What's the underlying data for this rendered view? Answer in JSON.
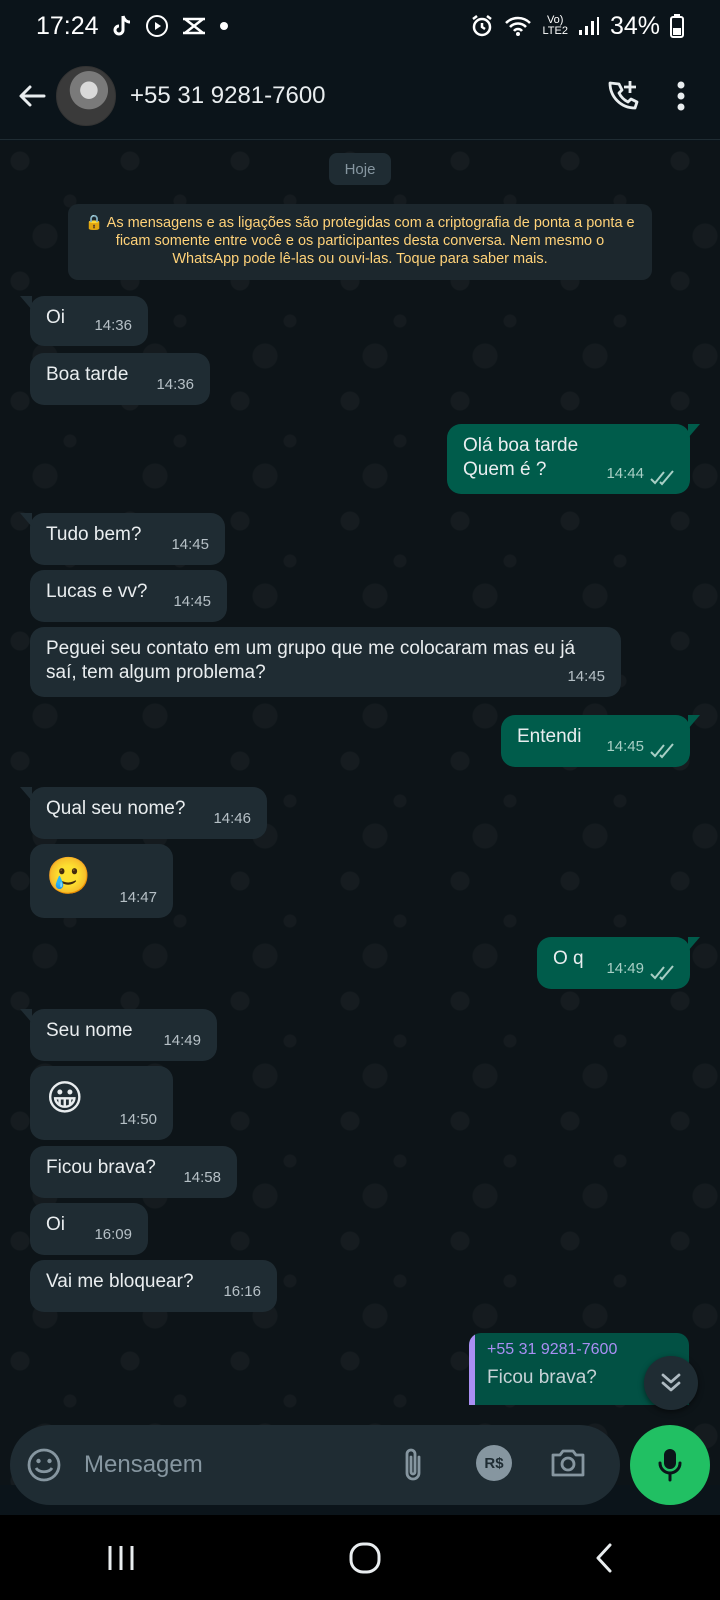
{
  "status_bar": {
    "time": "17:24",
    "battery": "34%",
    "network": "LTE2",
    "volte": "Vo)"
  },
  "header": {
    "contact_name": "+55 31 9281-7600"
  },
  "chat": {
    "date_chip": "Hoje",
    "encryption_notice": "🔒 As mensagens e as ligações são protegidas com a criptografia de ponta a ponta e ficam somente entre você e os participantes desta conversa. Nem mesmo o WhatsApp pode lê-las ou ouvi-las. Toque para saber mais.",
    "messages": [
      {
        "dir": "in",
        "text": "Oi",
        "time": "14:36"
      },
      {
        "dir": "in",
        "text": "Boa tarde",
        "time": "14:36"
      },
      {
        "dir": "out",
        "text": "Olá boa tarde\nQuem é ?",
        "time": "14:44"
      },
      {
        "dir": "in",
        "text": "Tudo bem?",
        "time": "14:45"
      },
      {
        "dir": "in",
        "text": "Lucas e vv?",
        "time": "14:45"
      },
      {
        "dir": "in",
        "text": "Peguei seu contato em um grupo que me colocaram mas eu já saí,  tem algum problema?",
        "time": "14:45"
      },
      {
        "dir": "out",
        "text": "Entendi",
        "time": "14:45"
      },
      {
        "dir": "in",
        "text": "Qual seu nome?",
        "time": "14:46"
      },
      {
        "dir": "in",
        "text": "🥲",
        "time": "14:47"
      },
      {
        "dir": "out",
        "text": "O q",
        "time": "14:49"
      },
      {
        "dir": "in",
        "text": "Seu nome",
        "time": "14:49"
      },
      {
        "dir": "in",
        "text": "😀",
        "time": "14:50"
      },
      {
        "dir": "in",
        "text": "Ficou brava?",
        "time": "14:58"
      },
      {
        "dir": "in",
        "text": "Oi",
        "time": "16:09"
      },
      {
        "dir": "in",
        "text": "Vai me bloquear?",
        "time": "16:16"
      }
    ],
    "reply_preview": {
      "name": "+55 31 9281-7600",
      "text": "Ficou brava?"
    }
  },
  "composer": {
    "placeholder": "Mensagem",
    "currency_label": "R$"
  },
  "icons": {
    "back": "back-arrow-icon",
    "add_call": "add-call-icon",
    "menu": "more-vert-icon",
    "emoji": "emoji-icon",
    "attach": "paperclip-icon",
    "payment": "payment-icon",
    "camera": "camera-icon",
    "mic": "mic-icon",
    "scroll_down": "double-chevron-down-icon"
  },
  "colors": {
    "incoming_bubble": "#1f2c33",
    "outgoing_bubble": "#005c4b",
    "accent_green": "#21c063",
    "read_ticks": "#a8cfc5"
  }
}
